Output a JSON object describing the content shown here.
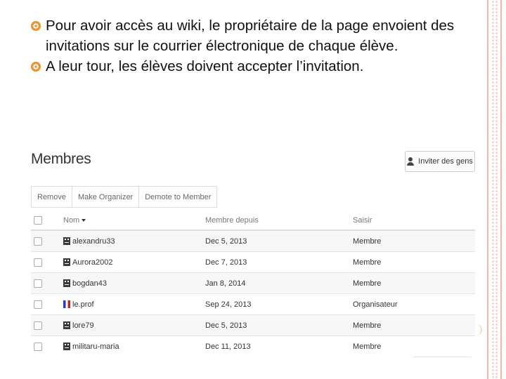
{
  "bullets": [
    "Pour avoir accès au wiki, le propriétaire de la page envoient des invitations sur le courrier électronique de chaque élève.",
    "A leur tour, les élèves doivent accepter l’invitation."
  ],
  "members_panel": {
    "title": "Membres",
    "invite_label": "Inviter des gens",
    "actions": [
      "Remove",
      "Make Organizer",
      "Demote to Member"
    ],
    "columns": {
      "name": "Nom",
      "since": "Membre depuis",
      "role": "Saisir"
    },
    "rows": [
      {
        "name": "alexandru33",
        "since": "Dec 5, 2013",
        "role": "Membre",
        "avatar": "default-avatar-icon"
      },
      {
        "name": "Aurora2002",
        "since": "Dec 7, 2013",
        "role": "Membre",
        "avatar": "default-avatar-icon"
      },
      {
        "name": "bogdan43",
        "since": "Jan 8, 2014",
        "role": "Membre",
        "avatar": "default-avatar-icon"
      },
      {
        "name": "le.prof",
        "since": "Sep 24, 2013",
        "role": "Organisateur",
        "avatar": "flag-avatar-icon"
      },
      {
        "name": "lore79",
        "since": "Dec 5, 2013",
        "role": "Membre",
        "avatar": "default-avatar-icon"
      },
      {
        "name": "militaru-maria",
        "since": "Dec 11, 2013",
        "role": "Membre",
        "avatar": "default-avatar-icon"
      }
    ]
  },
  "colors": {
    "bullet": "#e8922e",
    "border_accent": "#f2b8a6",
    "row_stripe": "#f7f7f7"
  }
}
